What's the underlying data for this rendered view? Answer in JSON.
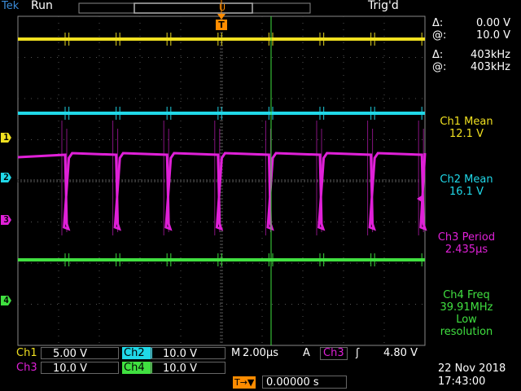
{
  "topbar": {
    "brand": "Tek",
    "run_status": "Run",
    "trigger_status": "Trig'd"
  },
  "trigger_marker": {
    "label": "T"
  },
  "channel_markers": {
    "ch1": "1",
    "ch2": "2",
    "ch3": "3",
    "ch4": "4"
  },
  "cursor_readout": {
    "delta_v_label": "Δ:",
    "delta_v": "0.00 V",
    "at_v_label": "@:",
    "at_v": "10.0 V",
    "delta_f_label": "Δ:",
    "delta_f": "403kHz",
    "at_f_label": "@:",
    "at_f": "403kHz"
  },
  "measurements": [
    {
      "label": "Ch1 Mean",
      "value": "12.1 V",
      "color": "#f0e020"
    },
    {
      "label": "Ch2 Mean",
      "value": "16.1 V",
      "color": "#20d8e8"
    },
    {
      "label": "Ch3 Period",
      "value": "2.435µs",
      "color": "#e020d8"
    },
    {
      "label": "Ch4 Freq",
      "value": "39.91MHz",
      "extra1": "Low",
      "extra2": "resolution",
      "color": "#40e040"
    }
  ],
  "bottom": {
    "ch1_label": "Ch1",
    "ch1_scale": "5.00 V",
    "ch2_label": "Ch2",
    "ch2_scale": "10.0 V",
    "ch3_label": "Ch3",
    "ch3_scale": "10.0 V",
    "ch4_label": "Ch4",
    "ch4_scale": "10.0 V",
    "timebase_label": "M",
    "timebase": "2.00µs",
    "trigger_mode": "A",
    "trigger_source": "Ch3",
    "trigger_slope": "ʃ",
    "trigger_level": "4.80 V",
    "position_label": "T→▼",
    "position": "0.00000 s",
    "date": "22 Nov 2018",
    "time": "17:43:00"
  },
  "colors": {
    "ch1": "#f0e020",
    "ch2": "#20d8e8",
    "ch3": "#e020d8",
    "ch4": "#40e040",
    "trigger": "#ff8c00",
    "grid": "#555555"
  }
}
